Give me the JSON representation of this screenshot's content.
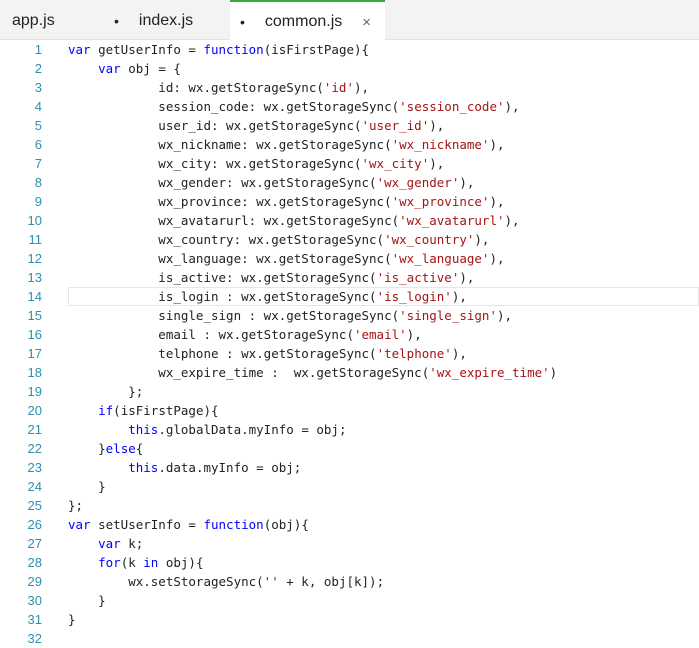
{
  "tabs": [
    {
      "name": "app.js",
      "modified": false,
      "active": false
    },
    {
      "name": "index.js",
      "modified": true,
      "active": false
    },
    {
      "name": "common.js",
      "modified": true,
      "active": true
    }
  ],
  "colors": {
    "keyword": "#0000ff",
    "string": "#a31515",
    "line_number": "#2b91af",
    "active_tab_accent": "#3ba83b"
  },
  "icons": {
    "modified_dot": "•",
    "close": "×"
  },
  "current_line": 14,
  "lines": [
    "[[var]] getUserInfo = [[function]](isFirstPage){",
    "    [[var]] obj = {",
    "            id: wx.getStorageSync({{'id'}}),",
    "            session_code: wx.getStorageSync({{'session_code'}}),",
    "            user_id: wx.getStorageSync({{'user_id'}}),",
    "            wx_nickname: wx.getStorageSync({{'wx_nickname'}}),",
    "            wx_city: wx.getStorageSync({{'wx_city'}}),",
    "            wx_gender: wx.getStorageSync({{'wx_gender'}}),",
    "            wx_province: wx.getStorageSync({{'wx_province'}}),",
    "            wx_avatarurl: wx.getStorageSync({{'wx_avatarurl'}}),",
    "            wx_country: wx.getStorageSync({{'wx_country'}}),",
    "            wx_language: wx.getStorageSync({{'wx_language'}}),",
    "            is_active: wx.getStorageSync({{'is_active'}}),",
    "            is_login : wx.getStorageSync({{'is_login'}}),",
    "            single_sign : wx.getStorageSync({{'single_sign'}}),",
    "            email : wx.getStorageSync({{'email'}}),",
    "            telphone : wx.getStorageSync({{'telphone'}}),",
    "            wx_expire_time :  wx.getStorageSync({{'wx_expire_time'}})",
    "        };",
    "    [[if]](isFirstPage){",
    "        [[this]].globalData.myInfo = obj;",
    "    }[[else]]{",
    "        [[this]].data.myInfo = obj;",
    "    }",
    "};",
    "[[var]] setUserInfo = [[function]](obj){",
    "    [[var]] k;",
    "    [[for]](k [[in]] obj){",
    "        wx.setStorageSync({{''}} + k, obj[k]);",
    "    }",
    "}",
    ""
  ]
}
